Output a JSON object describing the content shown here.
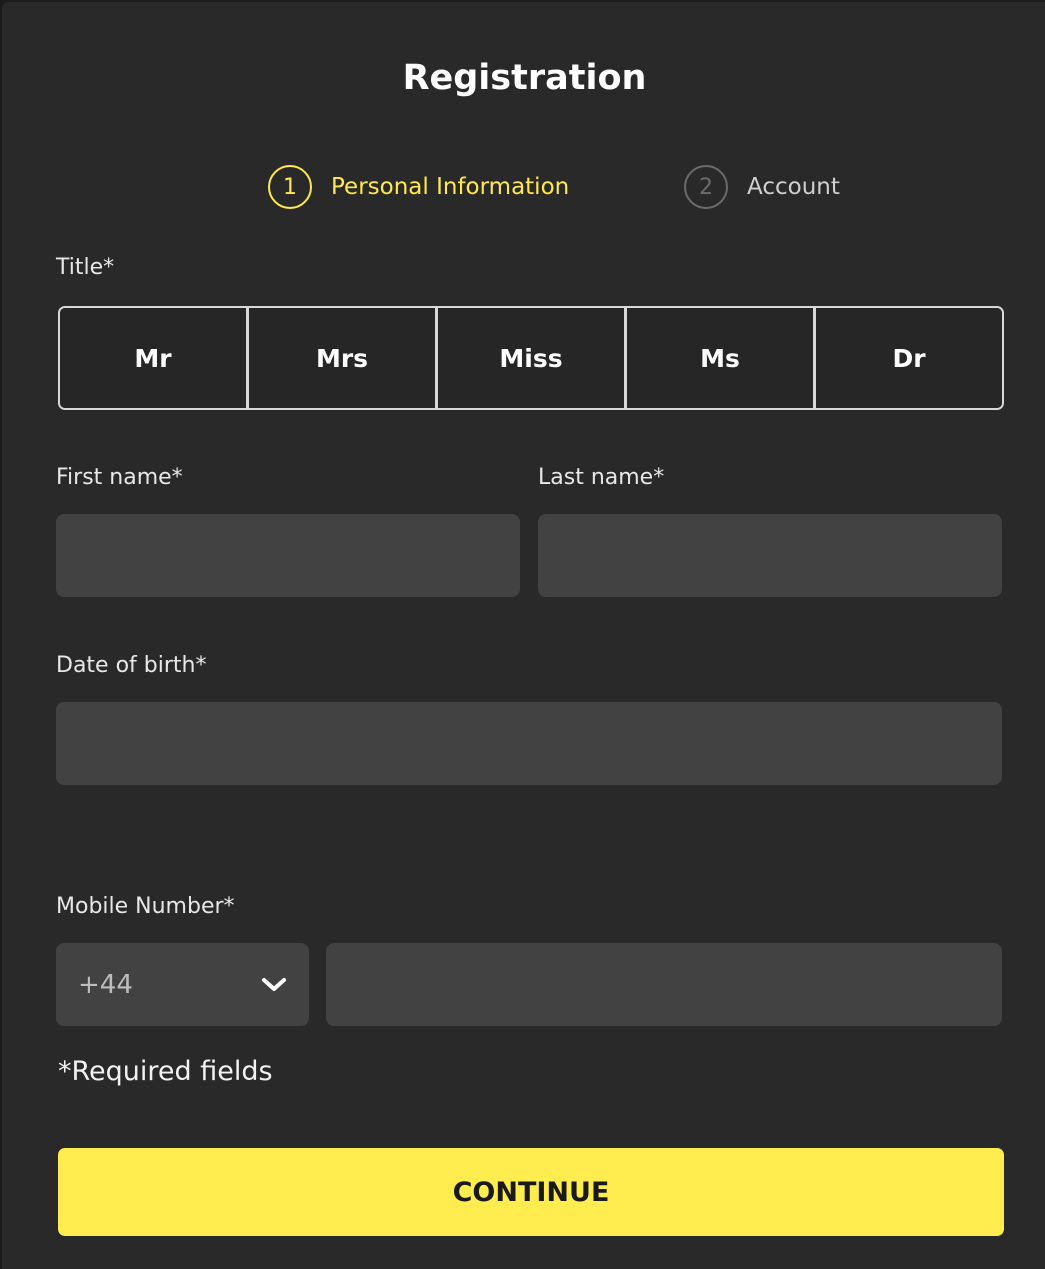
{
  "header": {
    "title": "Registration"
  },
  "stepper": {
    "steps": [
      {
        "number": "1",
        "label": "Personal Information",
        "state": "active"
      },
      {
        "number": "2",
        "label": "Account",
        "state": "inactive"
      }
    ]
  },
  "form": {
    "title_label": "Title*",
    "title_options": [
      "Mr",
      "Mrs",
      "Miss",
      "Ms",
      "Dr"
    ],
    "first_name": {
      "label": "First name*",
      "value": ""
    },
    "last_name": {
      "label": "Last name*",
      "value": ""
    },
    "dob": {
      "label": "Date of birth*",
      "value": ""
    },
    "mobile": {
      "label": "Mobile Number*",
      "country_code": "+44",
      "value": ""
    },
    "required_note": "*Required fields"
  },
  "actions": {
    "continue_label": "CONTINUE"
  },
  "colors": {
    "accent": "#ffec4f",
    "input_bg": "#424242",
    "panel_bg": "#292929"
  }
}
